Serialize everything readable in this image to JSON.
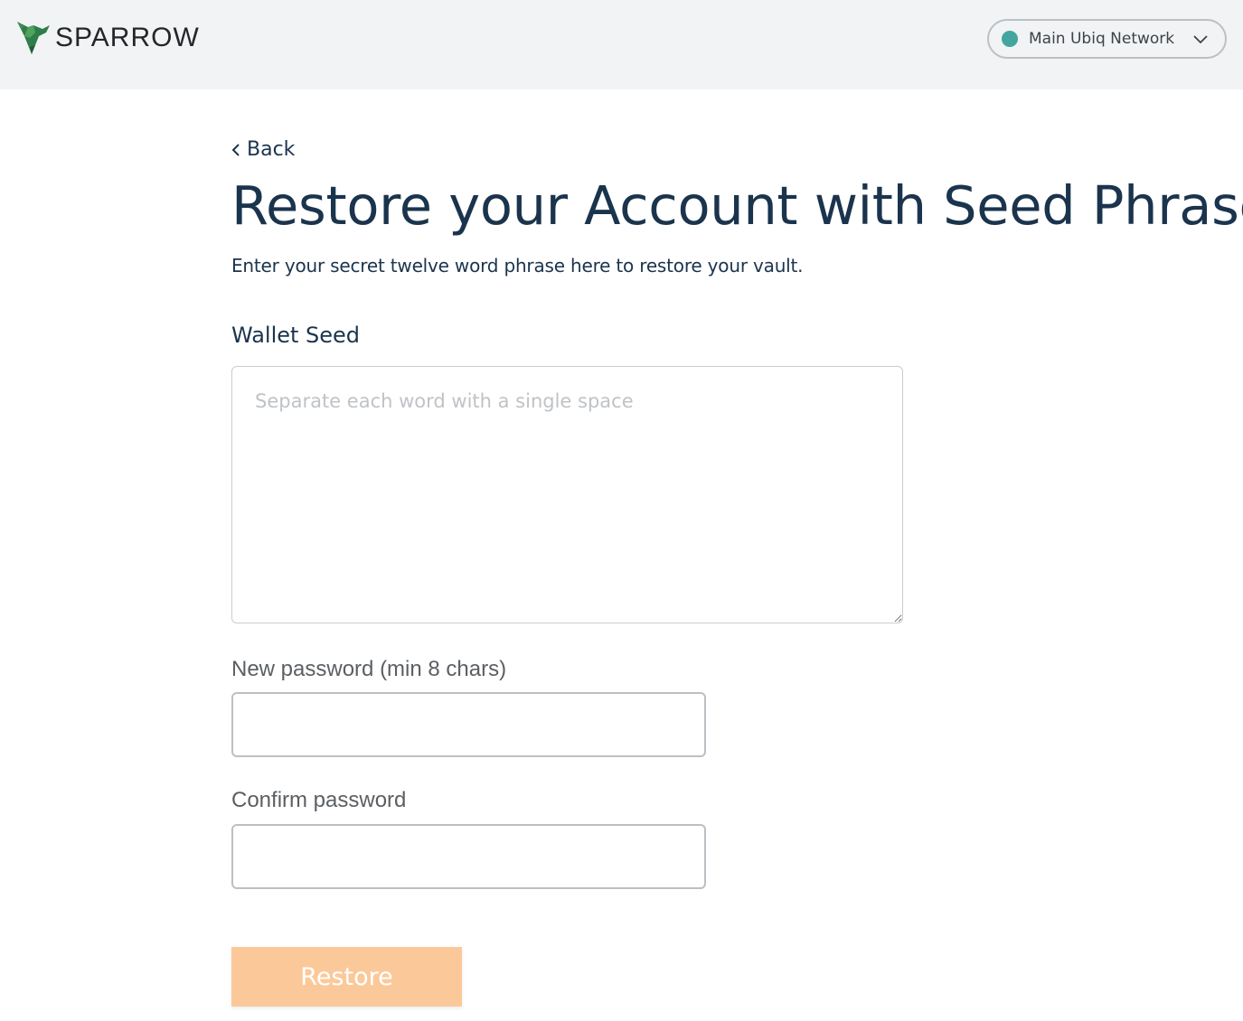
{
  "header": {
    "logo_text": "SPARROW",
    "network": {
      "label": "Main Ubiq Network",
      "status_color": "#43a59e"
    }
  },
  "back_label": "Back",
  "title": "Restore your Account with Seed Phrase",
  "subtitle": "Enter your secret twelve word phrase here to restore your vault.",
  "wallet_seed": {
    "label": "Wallet Seed",
    "placeholder": "Separate each word with a single space",
    "value": ""
  },
  "new_password": {
    "label": "New password (min 8 chars)",
    "value": ""
  },
  "confirm_password": {
    "label": "Confirm password",
    "value": ""
  },
  "restore_button": {
    "label": "Restore",
    "color": "#fbc999",
    "disabled": true
  },
  "icons": {
    "logo": "sparrow-bird-icon",
    "network_status": "status-dot-icon",
    "network_dropdown": "chevron-down-icon",
    "back": "chevron-left-icon"
  }
}
